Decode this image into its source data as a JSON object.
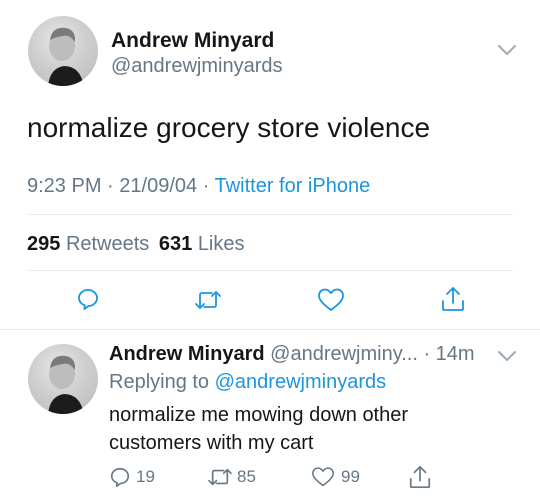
{
  "main_tweet": {
    "author_name": "Andrew Minyard",
    "author_handle": "@andrewjminyards",
    "text": "normalize grocery store violence",
    "time": "9:23 PM",
    "date": "21/09/04",
    "separator": "·",
    "source": "Twitter for iPhone",
    "retweets_count": "295",
    "retweets_label": "Retweets",
    "likes_count": "631",
    "likes_label": "Likes",
    "actions": [
      "reply-icon",
      "retweet-icon",
      "like-icon",
      "share-icon"
    ]
  },
  "reply": {
    "author_name": "Andrew Minyard",
    "author_handle": "@andrewjminy...",
    "time_ago": "· 14m",
    "replying_to_label": "Replying to",
    "replying_to_handle": "@andrewjminyards",
    "text_line1": "normalize me mowing down other",
    "text_line2": "customers with my cart",
    "reply_count": "19",
    "retweet_count": "85",
    "like_count": "99"
  },
  "colors": {
    "accent_blue": "#1b95e0",
    "muted_gray": "#657786",
    "divider": "#e6ecf0",
    "text": "#14171a"
  }
}
